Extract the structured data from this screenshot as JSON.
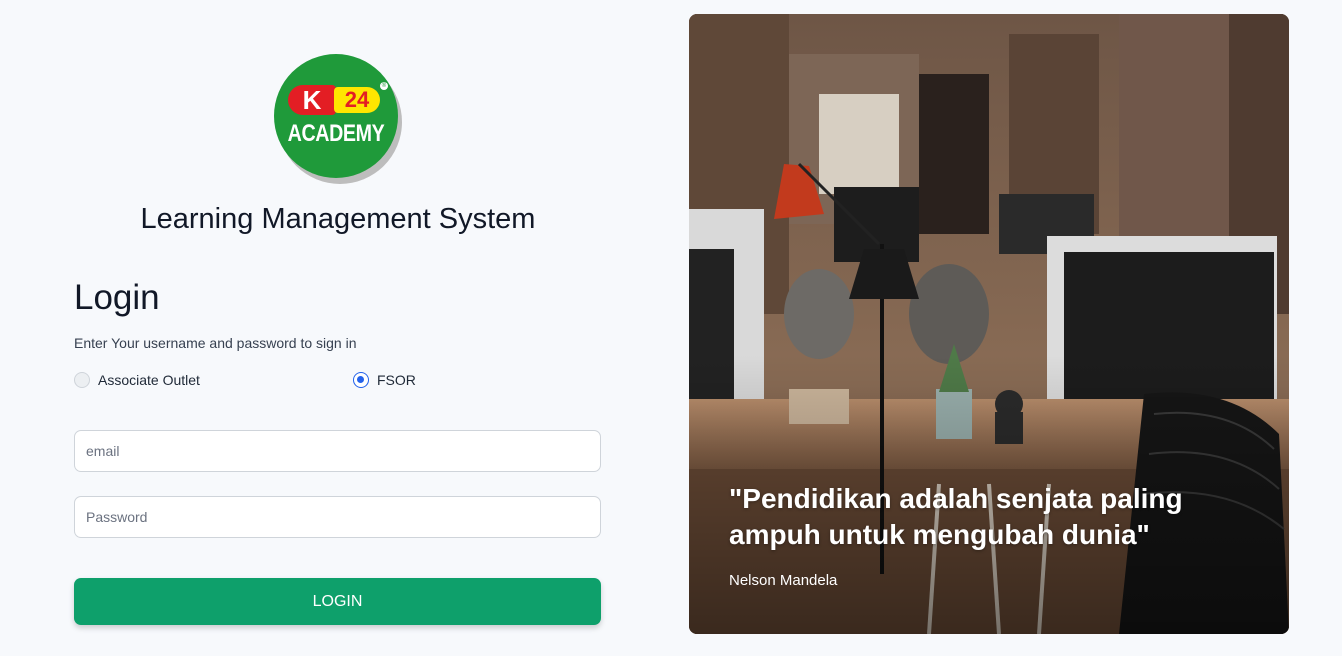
{
  "logo": {
    "badge_k": "K",
    "badge_number": "24",
    "registered": "®",
    "wordmark": "ACADEMY",
    "colors": {
      "circle": "#1f9a3a",
      "k": "#e31e24",
      "number_bg": "#ffe600"
    }
  },
  "app_title": "Learning Management System",
  "login": {
    "heading": "Login",
    "subtitle": "Enter Your username and password to sign in",
    "options": [
      {
        "label": "Associate Outlet",
        "selected": false
      },
      {
        "label": "FSOR",
        "selected": true
      }
    ],
    "email_placeholder": "email",
    "password_placeholder": "Password",
    "button_label": "LOGIN",
    "button_color": "#0ea06b"
  },
  "hero": {
    "image": "office-workspace-photo",
    "quote": "\"Pendidikan adalah senjata paling ampuh untuk mengubah dunia\"",
    "author": "Nelson Mandela"
  }
}
